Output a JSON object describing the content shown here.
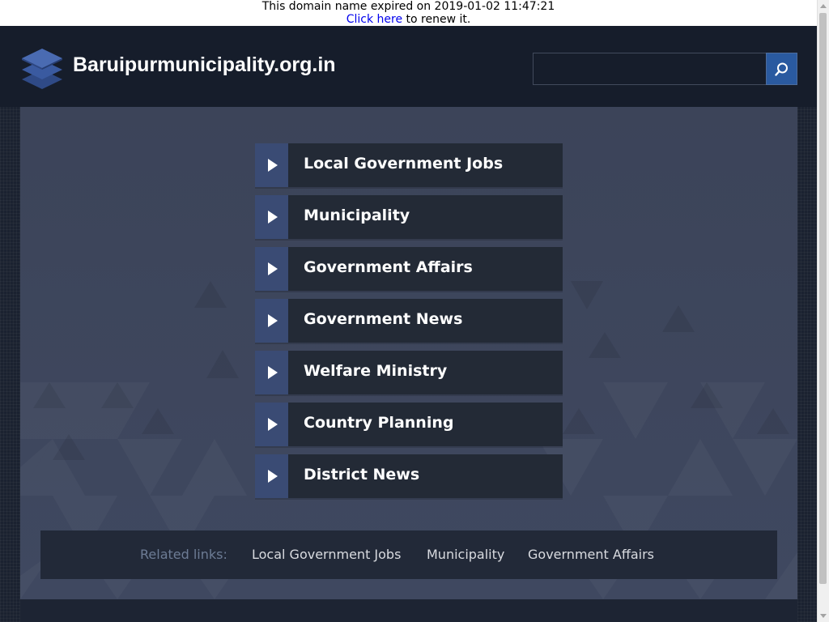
{
  "notice": {
    "expired_text": "This domain name expired on 2019-01-02 11:47:21",
    "link_text": "Click here",
    "renew_text": " to renew it."
  },
  "header": {
    "site_title": "Baruipurmunicipality.org.in",
    "search_placeholder": "",
    "search_icon": "search-icon",
    "logo_icon": "stacked-layers-icon"
  },
  "menu": {
    "items": [
      {
        "label": "Local Government Jobs"
      },
      {
        "label": "Municipality"
      },
      {
        "label": "Government Affairs"
      },
      {
        "label": "Government News"
      },
      {
        "label": "Welfare Ministry"
      },
      {
        "label": "Country Planning"
      },
      {
        "label": "District News"
      }
    ],
    "arrow_icon": "play-arrow-icon"
  },
  "related": {
    "label": "Related links:",
    "links": [
      {
        "label": "Local Government Jobs"
      },
      {
        "label": "Municipality"
      },
      {
        "label": "Government Affairs"
      }
    ]
  },
  "colors": {
    "header_bg": "#161d2b",
    "main_bg": "#3c4459",
    "menu_item_bg": "#232a36",
    "menu_arrow_bg": "#3a4b74",
    "search_button_bg": "#2a5aa0",
    "related_bg": "#222938",
    "related_label": "#6d7c95"
  }
}
